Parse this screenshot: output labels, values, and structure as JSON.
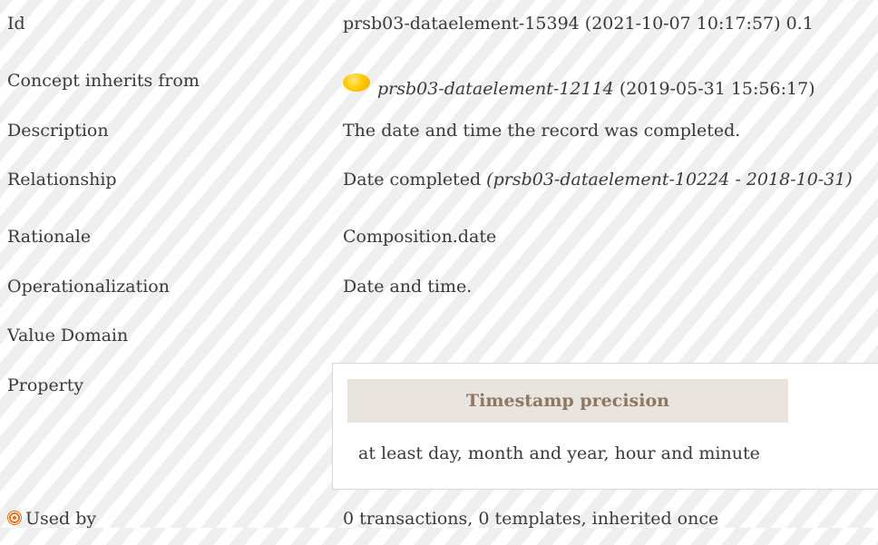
{
  "rows": {
    "id": {
      "label": "Id",
      "value": "prsb03-dataelement-15394 (2021-10-07 10:17:57) 0.1"
    },
    "concept_inherits_from": {
      "label": "Concept inherits from",
      "status_icon": "status-circle-icon",
      "status_color": "#ffcc00",
      "value_link": "prsb03-dataelement-12114",
      "value_date": "(2019-05-31 15:56:17)"
    },
    "description": {
      "label": "Description",
      "value": "The date and time the record was completed."
    },
    "relationship": {
      "label": "Relationship",
      "value": "Date completed",
      "reference": "(prsb03-dataelement-10224 - 2018-10-31)"
    },
    "rationale": {
      "label": "Rationale",
      "value": "Composition.date"
    },
    "operationalization": {
      "label": "Operationalization",
      "value": "Date and time."
    },
    "value_domain": {
      "label": "Value Domain",
      "value": ""
    },
    "property": {
      "label": "Property",
      "header": "Timestamp precision",
      "text": "at least day, month and year, hour and minute"
    },
    "used_by": {
      "icon": "target-icon",
      "icon_color": "#ff6a00",
      "label": "Used by",
      "value": "0 transactions, 0 templates, inherited once"
    }
  }
}
